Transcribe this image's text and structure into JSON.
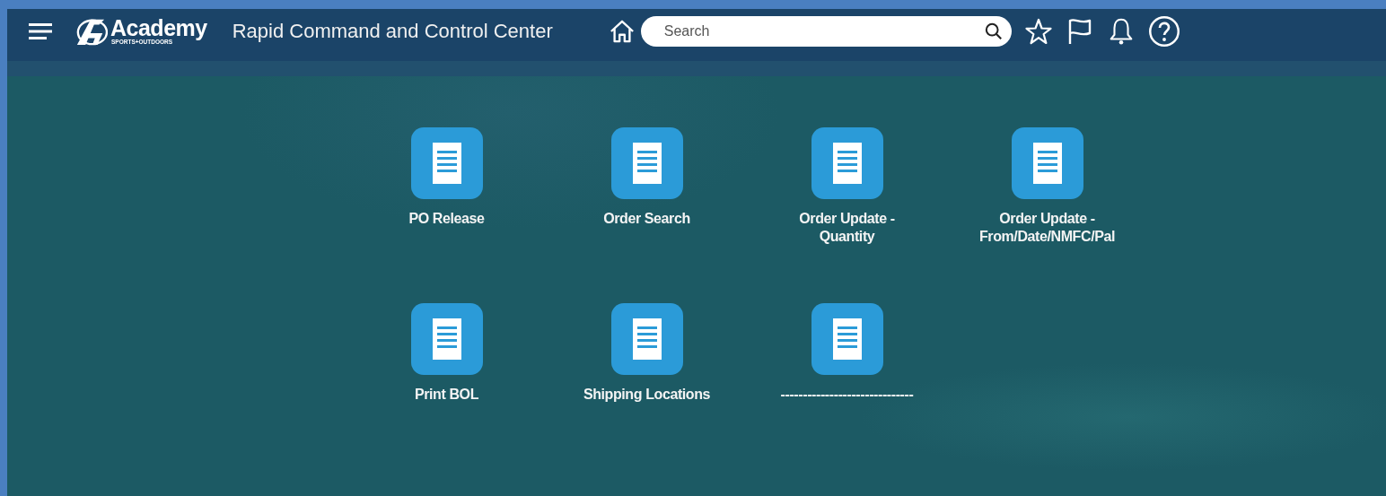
{
  "header": {
    "brand": "Academy",
    "brand_tagline": "SPORTS+OUTDOORS",
    "title": "Rapid Command and Control Center",
    "search": {
      "placeholder": "Search"
    }
  },
  "tiles": [
    {
      "lines": [
        "PO Release"
      ]
    },
    {
      "lines": [
        "Order Search"
      ]
    },
    {
      "lines": [
        "Order Update -",
        "Quantity"
      ]
    },
    {
      "lines": [
        "Order Update -",
        "From/Date/NMFC/Pal"
      ]
    },
    {
      "lines": [
        "Print BOL"
      ]
    },
    {
      "lines": [
        "Shipping Locations"
      ]
    },
    {
      "lines": [
        "------------------------------"
      ]
    }
  ]
}
